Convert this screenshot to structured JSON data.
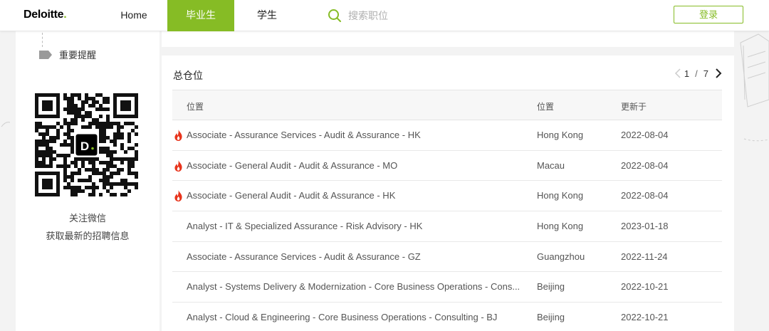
{
  "header": {
    "logo_text": "Deloitte",
    "logo_dot": ".",
    "nav": {
      "home": "Home",
      "graduate": "毕业生",
      "student": "学生"
    },
    "search_placeholder": "搜索职位",
    "login_label": "登录"
  },
  "sidebar": {
    "reminder_label": "重要提醒",
    "qr_caption_line1": "关注微信",
    "qr_caption_line2": "获取最新的招聘信息"
  },
  "main": {
    "title": "总仓位",
    "pager": {
      "current": "1",
      "separator": "/",
      "total": "7"
    },
    "columns": {
      "title": "位置",
      "location": "位置",
      "updated": "更新于"
    },
    "rows": [
      {
        "hot": true,
        "title": "Associate - Assurance Services - Audit & Assurance - HK",
        "location": "Hong Kong",
        "date": "2022-08-04"
      },
      {
        "hot": true,
        "title": "Associate - General Audit - Audit & Assurance - MO",
        "location": "Macau",
        "date": "2022-08-04"
      },
      {
        "hot": true,
        "title": "Associate - General Audit - Audit & Assurance - HK",
        "location": "Hong Kong",
        "date": "2022-08-04"
      },
      {
        "hot": false,
        "title": "Analyst - IT & Specialized Assurance - Risk Advisory - HK",
        "location": "Hong Kong",
        "date": "2023-01-18"
      },
      {
        "hot": false,
        "title": "Associate - Assurance Services - Audit & Assurance - GZ",
        "location": "Guangzhou",
        "date": "2022-11-24"
      },
      {
        "hot": false,
        "title": "Analyst - Systems Delivery & Modernization - Core Business Operations - Cons...",
        "location": "Beijing",
        "date": "2022-10-21"
      },
      {
        "hot": false,
        "title": "Analyst - Cloud & Engineering - Core Business Operations - Consulting - BJ",
        "location": "Beijing",
        "date": "2022-10-21"
      }
    ]
  },
  "colors": {
    "brand_green": "#86bc25",
    "hot_icon": "#e8341c"
  },
  "icons": [
    "search-icon",
    "tag-icon",
    "qr-code",
    "fire-icon",
    "chevron-left-icon",
    "chevron-right-icon"
  ]
}
